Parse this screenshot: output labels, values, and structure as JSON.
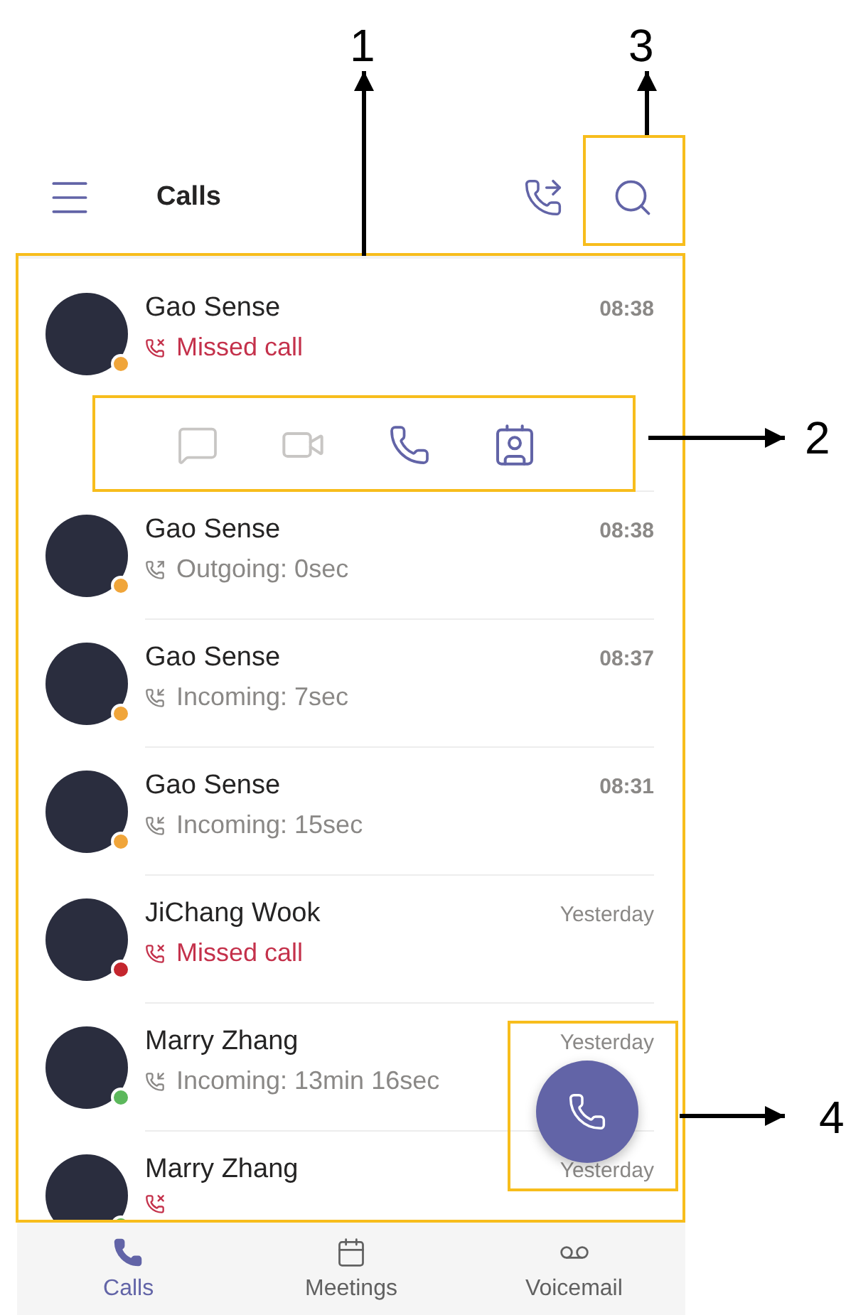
{
  "header": {
    "title": "Calls"
  },
  "calls": [
    {
      "name": "Gao Sense",
      "time": "08:38",
      "kind": "missed",
      "detail": "Missed call",
      "color": "#f0a53a",
      "expanded": true,
      "actions": [
        {
          "kind": "message",
          "disabled": true
        },
        {
          "kind": "video",
          "disabled": true
        },
        {
          "kind": "call",
          "disabled": false
        },
        {
          "kind": "contact",
          "disabled": false
        }
      ]
    },
    {
      "name": "Gao Sense",
      "time": "08:38",
      "kind": "outgoing",
      "detail": "Outgoing: 0sec",
      "color": "#f0a53a",
      "expanded": false
    },
    {
      "name": "Gao Sense",
      "time": "08:37",
      "kind": "incoming",
      "detail": "Incoming: 7sec",
      "color": "#f0a53a",
      "expanded": false
    },
    {
      "name": "Gao Sense",
      "time": "08:31",
      "kind": "incoming",
      "detail": "Incoming: 15sec",
      "color": "#f0a53a",
      "expanded": false
    },
    {
      "name": "JiChang Wook",
      "time": "Yesterday",
      "kind": "missed",
      "detail": "Missed call",
      "color": "#c4262e",
      "expanded": false
    },
    {
      "name": "Marry Zhang",
      "time": "Yesterday",
      "kind": "incoming",
      "detail": "Incoming: 13min 16sec",
      "color": "#5cb85c",
      "expanded": false
    },
    {
      "name": "Marry Zhang",
      "time": "Yesterday",
      "kind": "missed",
      "color": "#5cb85c",
      "expanded": false
    }
  ],
  "nav": [
    {
      "label": "Calls",
      "kind": "calls",
      "selected": true
    },
    {
      "label": "Meetings",
      "kind": "meetings",
      "selected": false
    },
    {
      "label": "Voicemail",
      "kind": "voicemail",
      "selected": false
    }
  ],
  "callouts": [
    {
      "label": "1"
    },
    {
      "label": "2"
    },
    {
      "label": "3"
    },
    {
      "label": "4"
    }
  ]
}
